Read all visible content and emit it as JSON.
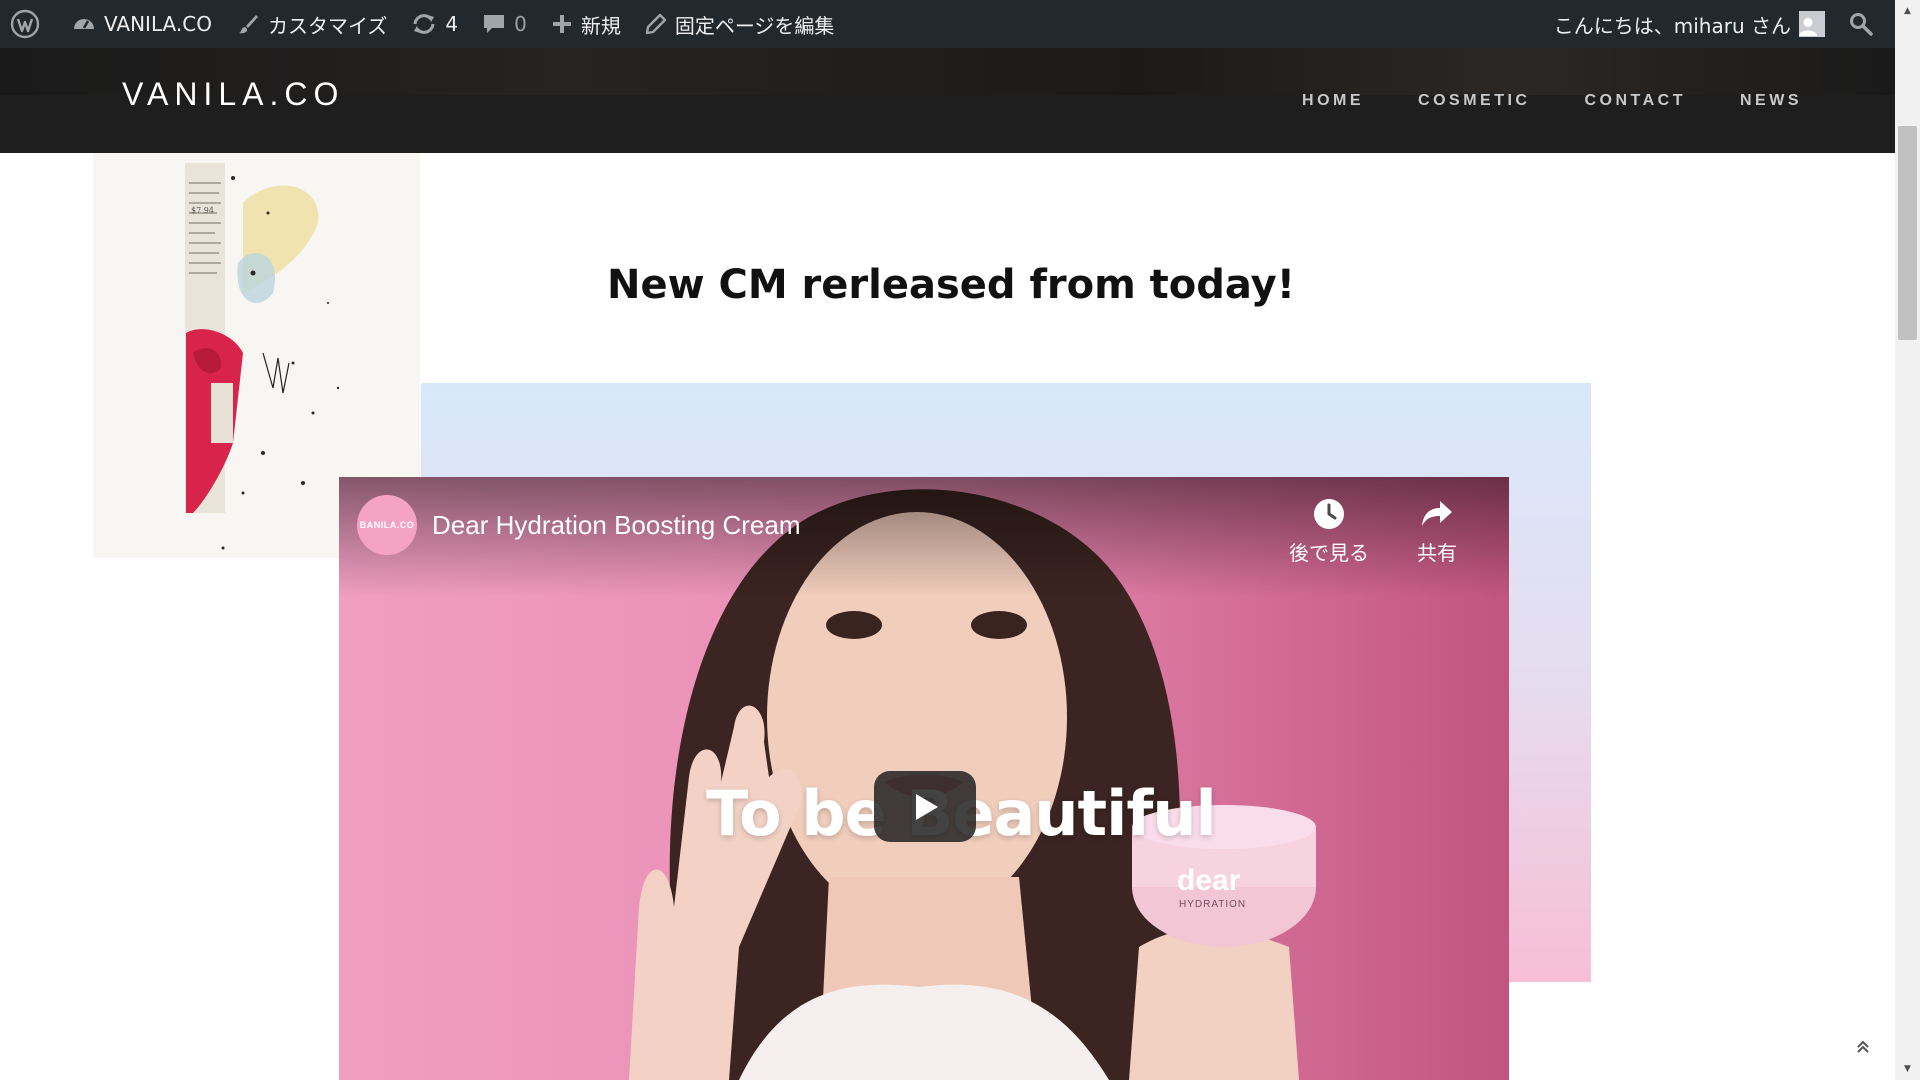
{
  "admin_bar": {
    "site_name": "VANILA.CO",
    "customize_label": "カスタマイズ",
    "updates_count": "4",
    "comments_count": "0",
    "new_label": "新規",
    "edit_page_label": "固定ページを編集",
    "greeting": "こんにちは、miharu さん",
    "icons": [
      "wordpress-icon",
      "dashboard-icon",
      "brush-icon",
      "refresh-icon",
      "comment-icon",
      "plus-icon",
      "pencil-icon",
      "avatar",
      "search-icon"
    ]
  },
  "header": {
    "logo": "VANILA.CO",
    "nav": [
      "HOME",
      "COSMETIC",
      "CONTACT",
      "NEWS"
    ]
  },
  "main": {
    "headline": "New CM rerleased from today!"
  },
  "video": {
    "channel_logo_text": "BANILA.CO",
    "title": "Dear Hydration Boosting Cream",
    "watch_later_label": "後で見る",
    "share_label": "共有",
    "overlay_text": "To be Beautiful",
    "product_label": "dear",
    "product_sublabel": "HYDRATION"
  },
  "colors": {
    "admin_bar_bg": "#23282d",
    "header_bg": "#1e1e1e",
    "gradient_top": "#d8e8fb",
    "gradient_bottom": "#f7bed6",
    "video_bg": "#c9729a"
  }
}
